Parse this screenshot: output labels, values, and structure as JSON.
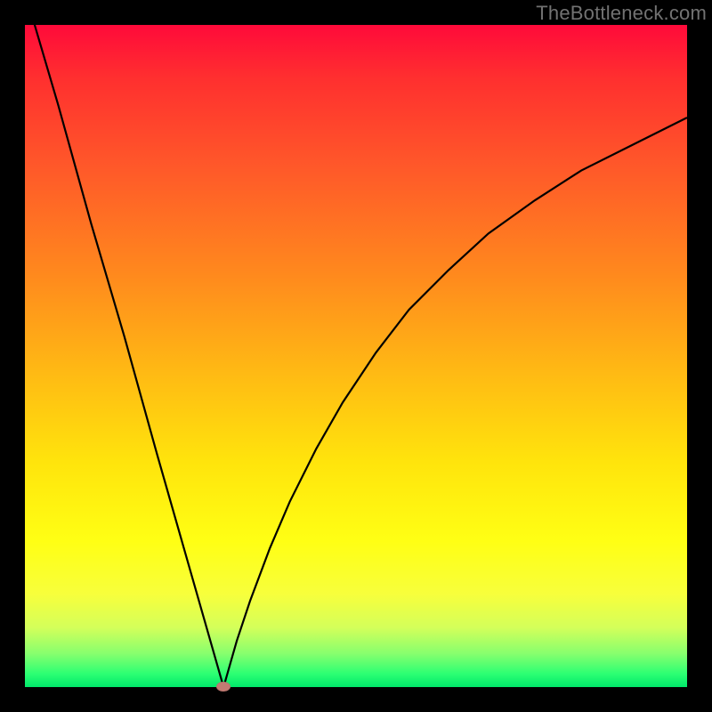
{
  "watermark": "TheBottleneck.com",
  "chart_data": {
    "type": "line",
    "title": "",
    "xlabel": "",
    "ylabel": "",
    "xlim": [
      0,
      100
    ],
    "ylim": [
      0,
      100
    ],
    "series": [
      {
        "name": "curve",
        "x": [
          0,
          5,
          10,
          15,
          20,
          23,
          26,
          29,
          30,
          31,
          32,
          34,
          37,
          40,
          44,
          48,
          53,
          58,
          64,
          70,
          77,
          84,
          92,
          100
        ],
        "y": [
          105,
          88,
          70,
          53,
          35,
          24.5,
          14,
          3.5,
          0,
          3.5,
          7,
          13,
          21,
          28,
          36,
          43,
          50.5,
          57,
          63,
          68.5,
          73.5,
          78,
          82,
          86
        ]
      }
    ],
    "marker": {
      "x": 30,
      "y": 0
    },
    "colors": {
      "curve": "#000000",
      "marker": "#c37b73",
      "gradient_top": "#ff0a3a",
      "gradient_mid": "#ffe40c",
      "gradient_bottom": "#00e86a",
      "frame": "#000000"
    }
  }
}
